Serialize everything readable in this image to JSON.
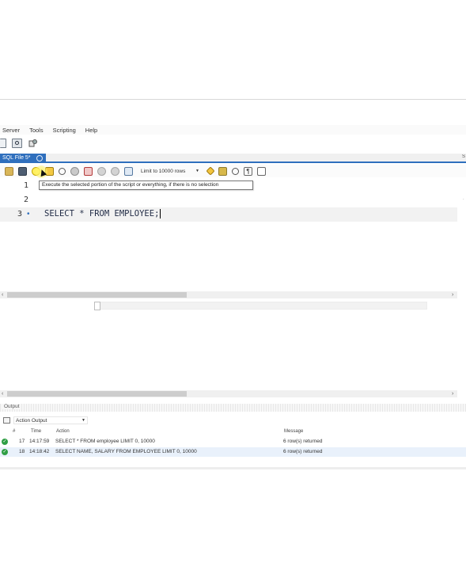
{
  "menu": [
    "Server",
    "Tools",
    "Scripting",
    "Help"
  ],
  "tab": {
    "label": "SQL File 5*"
  },
  "sql_toolbar": {
    "limit_label": "Limit to 10000 rows",
    "tooltip": "Execute the selected portion of the script or everything, if there is no selection"
  },
  "editor": {
    "line_numbers": [
      "1",
      "2",
      "3"
    ],
    "active_marker": "•",
    "code_line": "SELECT * FROM EMPLOYEE;"
  },
  "output": {
    "section_label": "Output",
    "selector_label": "Action Output",
    "headers": {
      "num": "#",
      "time": "Time",
      "action": "Action",
      "message": "Message"
    },
    "rows": [
      {
        "num": "17",
        "time": "14:17:59",
        "action": "SELECT * FROM employee LIMIT 0, 10000",
        "message": "6 row(s) returned"
      },
      {
        "num": "18",
        "time": "14:18:42",
        "action": "SELECT NAME, SALARY FROM EMPLOYEE LIMIT 0, 10000",
        "message": "6 row(s) returned"
      }
    ]
  },
  "colors": {
    "accent": "#2f6fbd",
    "success": "#2f9e44",
    "cursor_highlight": "#fff36a"
  }
}
